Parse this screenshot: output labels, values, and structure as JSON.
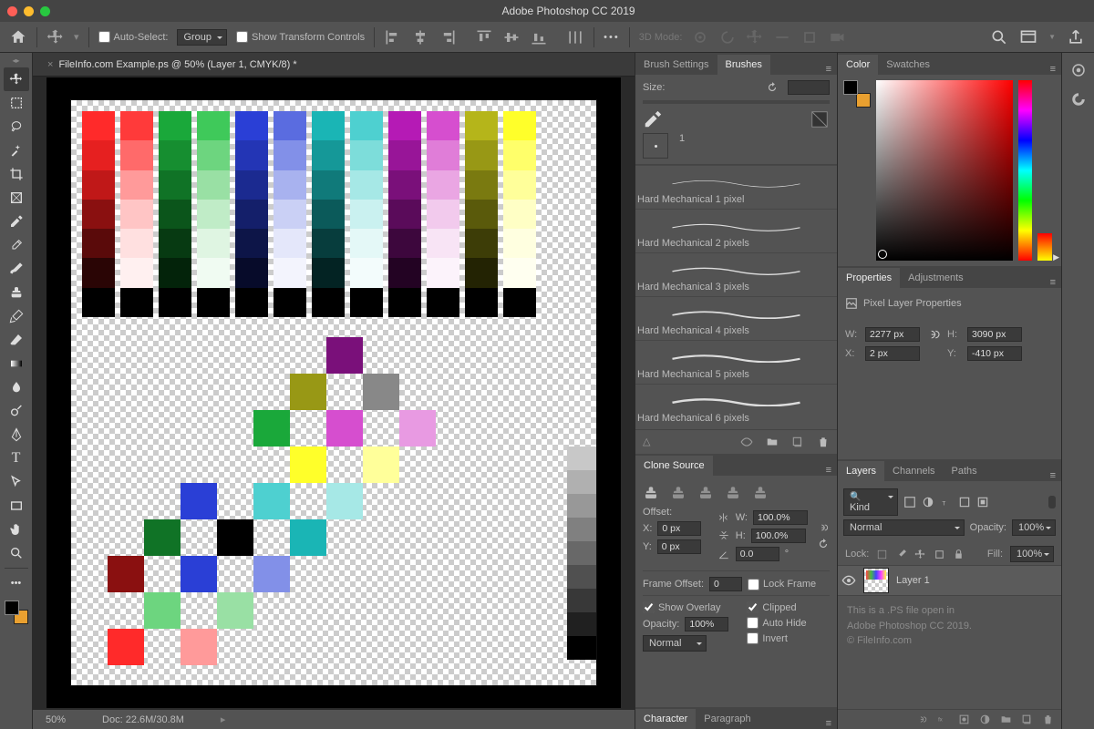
{
  "app_title": "Adobe Photoshop CC 2019",
  "options": {
    "auto_select": "Auto-Select:",
    "group": "Group",
    "show_transform": "Show Transform Controls",
    "mode_3d": "3D Mode:"
  },
  "doc_tab": "FileInfo.com Example.ps @ 50% (Layer 1, CMYK/8) *",
  "status": {
    "zoom": "50%",
    "doc": "Doc: 22.6M/30.8M"
  },
  "brushes": {
    "tab_settings": "Brush Settings",
    "tab_brushes": "Brushes",
    "size_label": "Size:",
    "presets": [
      "Hard Mechanical 1 pixel",
      "Hard Mechanical 2 pixels",
      "Hard Mechanical 3 pixels",
      "Hard Mechanical 4 pixels",
      "Hard Mechanical 5 pixels",
      "Hard Mechanical 6 pixels"
    ],
    "brush_num": "1"
  },
  "clone": {
    "title": "Clone Source",
    "offset": "Offset:",
    "x": "X:",
    "y": "Y:",
    "xval": "0 px",
    "yval": "0 px",
    "w": "W:",
    "h": "H:",
    "wval": "100.0%",
    "hval": "100.0%",
    "angle": "0.0",
    "frame_offset": "Frame Offset:",
    "frame_val": "0",
    "lock_frame": "Lock Frame",
    "show_overlay": "Show Overlay",
    "opacity": "Opacity:",
    "opacity_val": "100%",
    "clipped": "Clipped",
    "auto_hide": "Auto Hide",
    "invert": "Invert",
    "blend": "Normal"
  },
  "char_para": {
    "char": "Character",
    "para": "Paragraph"
  },
  "color": {
    "tab_color": "Color",
    "tab_swatches": "Swatches"
  },
  "properties": {
    "tab_props": "Properties",
    "tab_adjust": "Adjustments",
    "layer_type": "Pixel Layer Properties",
    "w": "2277 px",
    "h": "3090 px",
    "x": "2 px",
    "y": "-410 px"
  },
  "layers": {
    "tab_layers": "Layers",
    "tab_channels": "Channels",
    "tab_paths": "Paths",
    "kind": "Kind",
    "blend": "Normal",
    "opacity_label": "Opacity:",
    "opacity": "100%",
    "lock": "Lock:",
    "fill_label": "Fill:",
    "fill": "100%",
    "layer1": "Layer 1"
  },
  "caption": {
    "l1": "This is a .PS file open in",
    "l2": "Adobe Photoshop CC 2019.",
    "l3": "© FileInfo.com"
  }
}
